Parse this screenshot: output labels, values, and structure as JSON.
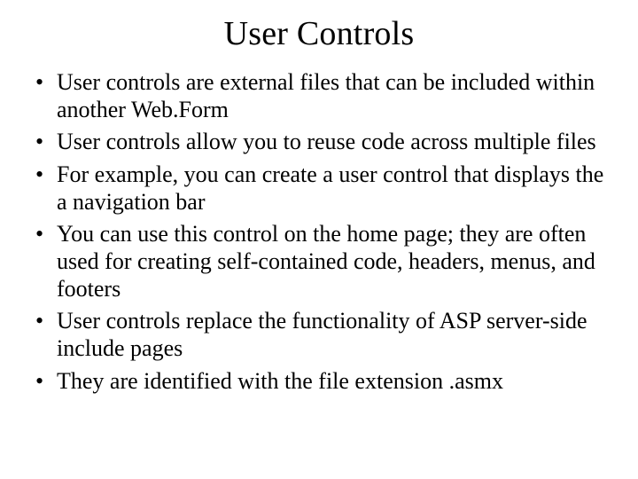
{
  "title": "User Controls",
  "bullets": [
    "User controls are external files that can be included within another Web.Form",
    "User controls allow you to reuse code across multiple files",
    "For example, you can create a user control that displays the a navigation bar",
    "You can use this control on the home page; they are often used for creating self-contained code, headers, menus, and footers",
    "User controls replace the functionality of ASP server-side include pages",
    "They are identified with the file extension .asmx"
  ]
}
